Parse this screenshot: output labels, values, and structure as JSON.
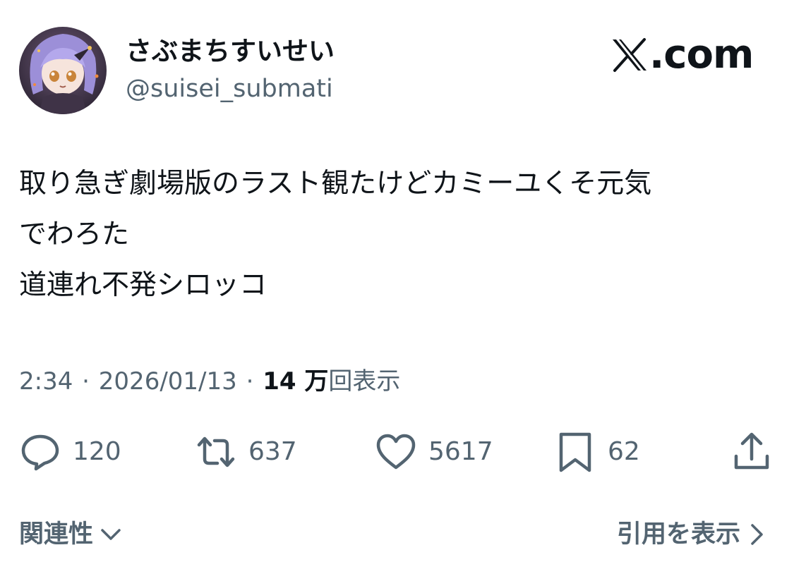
{
  "author": {
    "display_name": "さぶまちすいせい",
    "handle": "@suisei_submati",
    "avatar_icon": "anime-avatar-icon"
  },
  "brand": {
    "text": ".com",
    "icon": "x-logo-icon"
  },
  "tweet": {
    "text": "取り急ぎ劇場版のラスト観たけどカミーユくそ元気\nでわろた\n道連れ不発シロッコ"
  },
  "meta": {
    "time": "2:34",
    "separator": "·",
    "date": "2026/01/13",
    "views_count": "14 万",
    "views_label": "回表示"
  },
  "actions": {
    "reply": {
      "icon": "reply-icon",
      "count": "120"
    },
    "retweet": {
      "icon": "retweet-icon",
      "count": "637"
    },
    "like": {
      "icon": "heart-icon",
      "count": "5617"
    },
    "bookmark": {
      "icon": "bookmark-icon",
      "count": "62"
    },
    "share": {
      "icon": "share-icon"
    }
  },
  "footer": {
    "related_label": "関連性",
    "related_icon": "chevron-down-icon",
    "quotes_label": "引用を表示",
    "quotes_icon": "chevron-right-icon"
  },
  "colors": {
    "text_primary": "#0f1419",
    "text_secondary": "#536471",
    "background": "#ffffff"
  }
}
